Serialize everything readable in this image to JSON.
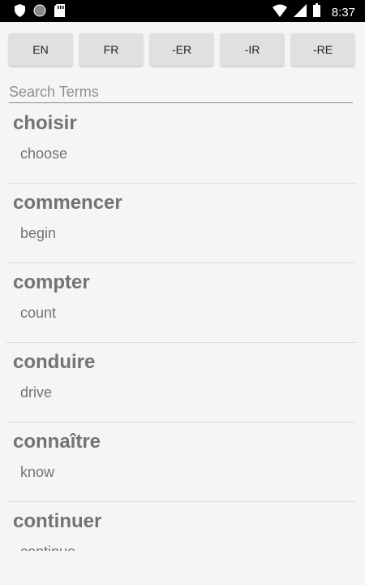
{
  "status_bar": {
    "time": "8:37",
    "left_icons": [
      "shield-icon",
      "circle-icon",
      "sd-card-icon"
    ],
    "right_icons": [
      "wifi-icon",
      "signal-icon",
      "battery-icon"
    ]
  },
  "buttons": [
    {
      "label": "EN"
    },
    {
      "label": "FR"
    },
    {
      "label": "-ER"
    },
    {
      "label": "-IR"
    },
    {
      "label": "-RE"
    }
  ],
  "search": {
    "placeholder": "Search Terms",
    "value": ""
  },
  "terms": [
    {
      "term": "choisir",
      "translation": "choose"
    },
    {
      "term": "commencer",
      "translation": "begin"
    },
    {
      "term": "compter",
      "translation": "count"
    },
    {
      "term": "conduire",
      "translation": "drive"
    },
    {
      "term": "connaître",
      "translation": "know"
    },
    {
      "term": "continuer",
      "translation": "continue"
    }
  ]
}
